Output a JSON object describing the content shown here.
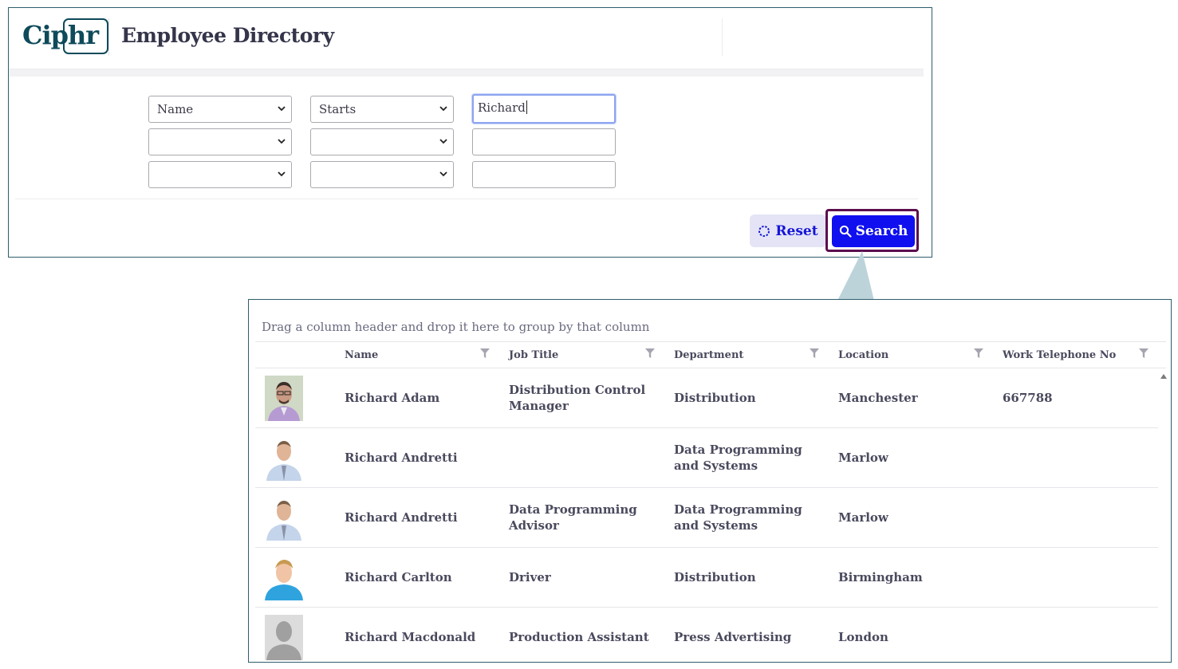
{
  "app": {
    "logo_text": "Ciphr",
    "title": "Employee Directory"
  },
  "search_form": {
    "rows": [
      {
        "field": "Name",
        "operator": "Starts",
        "value": "Richard"
      },
      {
        "field": "",
        "operator": "",
        "value": ""
      },
      {
        "field": "",
        "operator": "",
        "value": ""
      }
    ],
    "reset_label": "Reset",
    "search_label": "Search"
  },
  "results": {
    "group_hint": "Drag a column header and drop it here to group by that column",
    "columns": [
      "Name",
      "Job Title",
      "Department",
      "Location",
      "Work Telephone No"
    ],
    "rows": [
      {
        "name": "Richard Adam",
        "job_title": "Distribution Control Manager",
        "department": "Distribution",
        "location": "Manchester",
        "telephone": "667788",
        "avatar": "photo-man-glasses"
      },
      {
        "name": "Richard Andretti",
        "job_title": "",
        "department": "Data Programming and Systems",
        "location": "Marlow",
        "telephone": "",
        "avatar": "photo-man-shirt-tie"
      },
      {
        "name": "Richard Andretti",
        "job_title": "Data Programming Advisor",
        "department": "Data Programming and Systems",
        "location": "Marlow",
        "telephone": "",
        "avatar": "photo-man-shirt-tie"
      },
      {
        "name": "Richard Carlton",
        "job_title": "Driver",
        "department": "Distribution",
        "location": "Birmingham",
        "telephone": "",
        "avatar": "photo-young-man-blue-shirt"
      },
      {
        "name": "Richard Macdonald",
        "job_title": "Production Assistant",
        "department": "Press Advertising",
        "location": "London",
        "telephone": "",
        "avatar": "silhouette-placeholder"
      }
    ]
  },
  "colors": {
    "brand": "#0e4a5a",
    "search_button": "#0f0ff0",
    "reset_button_bg": "#e4e4f6",
    "highlight_border": "#5c0e4f",
    "pointer": "#bcd3da"
  }
}
